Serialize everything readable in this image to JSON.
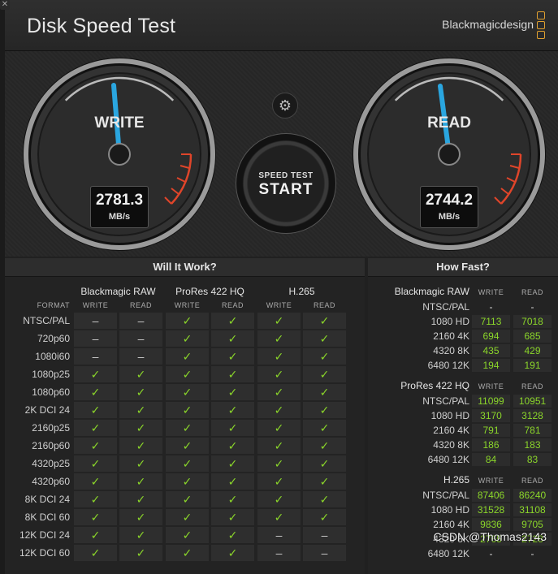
{
  "window": {
    "close_glyph": "✕",
    "title": "Disk Speed Test",
    "brand": "Blackmagicdesign"
  },
  "gauges": {
    "write": {
      "label": "WRITE",
      "value": "2781.3",
      "unit": "MB/s"
    },
    "read": {
      "label": "READ",
      "value": "2744.2",
      "unit": "MB/s"
    }
  },
  "settings_icon": "⚙",
  "start_button": {
    "line1": "SPEED TEST",
    "line2": "START"
  },
  "will_it_work": {
    "title": "Will It Work?",
    "format_label": "FORMAT",
    "groups": [
      "Blackmagic RAW",
      "ProRes 422 HQ",
      "H.265"
    ],
    "col_labels": [
      "WRITE",
      "READ"
    ],
    "rows": [
      {
        "format": "NTSC/PAL",
        "cells": [
          "–",
          "–",
          "✓",
          "✓",
          "✓",
          "✓"
        ]
      },
      {
        "format": "720p60",
        "cells": [
          "–",
          "–",
          "✓",
          "✓",
          "✓",
          "✓"
        ]
      },
      {
        "format": "1080i60",
        "cells": [
          "–",
          "–",
          "✓",
          "✓",
          "✓",
          "✓"
        ]
      },
      {
        "format": "1080p25",
        "cells": [
          "✓",
          "✓",
          "✓",
          "✓",
          "✓",
          "✓"
        ]
      },
      {
        "format": "1080p60",
        "cells": [
          "✓",
          "✓",
          "✓",
          "✓",
          "✓",
          "✓"
        ]
      },
      {
        "format": "2K DCI 24",
        "cells": [
          "✓",
          "✓",
          "✓",
          "✓",
          "✓",
          "✓"
        ]
      },
      {
        "format": "2160p25",
        "cells": [
          "✓",
          "✓",
          "✓",
          "✓",
          "✓",
          "✓"
        ]
      },
      {
        "format": "2160p60",
        "cells": [
          "✓",
          "✓",
          "✓",
          "✓",
          "✓",
          "✓"
        ]
      },
      {
        "format": "4320p25",
        "cells": [
          "✓",
          "✓",
          "✓",
          "✓",
          "✓",
          "✓"
        ]
      },
      {
        "format": "4320p60",
        "cells": [
          "✓",
          "✓",
          "✓",
          "✓",
          "✓",
          "✓"
        ]
      },
      {
        "format": "8K DCI 24",
        "cells": [
          "✓",
          "✓",
          "✓",
          "✓",
          "✓",
          "✓"
        ]
      },
      {
        "format": "8K DCI 60",
        "cells": [
          "✓",
          "✓",
          "✓",
          "✓",
          "✓",
          "✓"
        ]
      },
      {
        "format": "12K DCI 24",
        "cells": [
          "✓",
          "✓",
          "✓",
          "✓",
          "–",
          "–"
        ]
      },
      {
        "format": "12K DCI 60",
        "cells": [
          "✓",
          "✓",
          "✓",
          "✓",
          "–",
          "–"
        ]
      }
    ]
  },
  "how_fast": {
    "title": "How Fast?",
    "col_labels": [
      "WRITE",
      "READ"
    ],
    "groups": [
      {
        "name": "Blackmagic RAW",
        "rows": [
          {
            "format": "NTSC/PAL",
            "write": "-",
            "read": "-"
          },
          {
            "format": "1080 HD",
            "write": "7113",
            "read": "7018"
          },
          {
            "format": "2160 4K",
            "write": "694",
            "read": "685"
          },
          {
            "format": "4320 8K",
            "write": "435",
            "read": "429"
          },
          {
            "format": "6480 12K",
            "write": "194",
            "read": "191"
          }
        ]
      },
      {
        "name": "ProRes 422 HQ",
        "rows": [
          {
            "format": "NTSC/PAL",
            "write": "11099",
            "read": "10951"
          },
          {
            "format": "1080 HD",
            "write": "3170",
            "read": "3128"
          },
          {
            "format": "2160 4K",
            "write": "791",
            "read": "781"
          },
          {
            "format": "4320 8K",
            "write": "186",
            "read": "183"
          },
          {
            "format": "6480 12K",
            "write": "84",
            "read": "83"
          }
        ]
      },
      {
        "name": "H.265",
        "rows": [
          {
            "format": "NTSC/PAL",
            "write": "87406",
            "read": "86240"
          },
          {
            "format": "1080 HD",
            "write": "31528",
            "read": "31108"
          },
          {
            "format": "2160 4K",
            "write": "9836",
            "read": "9705"
          },
          {
            "format": "4320 8K",
            "write": "2765",
            "read": "2728"
          },
          {
            "format": "6480 12K",
            "write": "-",
            "read": "-"
          }
        ]
      }
    ]
  },
  "watermark": "CSDN @Thomas2143",
  "colors": {
    "accent_green": "#8bd62a",
    "needle_blue": "#2aa6e0",
    "redline": "#e0452a",
    "brand_orange": "#e0a030"
  }
}
